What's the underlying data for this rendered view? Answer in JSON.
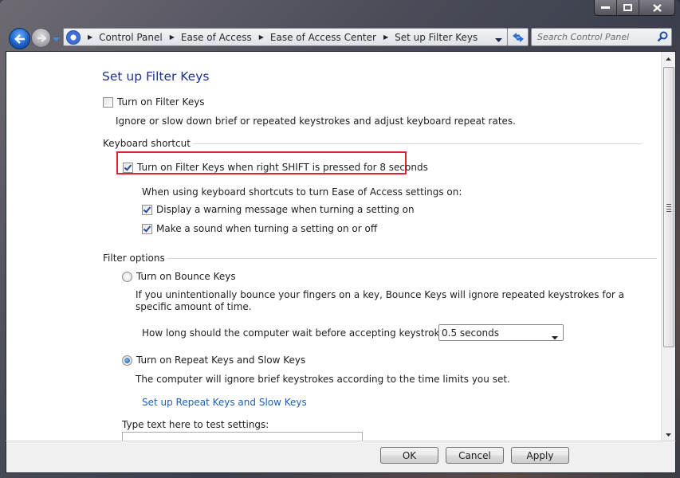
{
  "window": {
    "caption_buttons": {
      "minimize": "minimize",
      "maximize": "maximize",
      "close": "close"
    }
  },
  "nav": {
    "back_icon": "back-arrow",
    "forward_icon": "forward-arrow",
    "recent_pages_icon": "chevron-down"
  },
  "address_bar": {
    "icon": "control-panel-icon",
    "breadcrumbs": [
      "Control Panel",
      "Ease of Access",
      "Ease of Access Center",
      "Set up Filter Keys"
    ]
  },
  "search": {
    "placeholder": "Search Control Panel",
    "value": ""
  },
  "page": {
    "title": "Set up Filter Keys",
    "turn_on_filter_keys": {
      "label": "Turn on Filter Keys",
      "checked": false
    },
    "turn_on_filter_keys_desc": "Ignore or slow down brief or repeated keystrokes and adjust keyboard repeat rates.",
    "keyboard_shortcut": {
      "heading": "Keyboard shortcut",
      "shift_shortcut": {
        "label": "Turn on Filter Keys when right SHIFT is pressed for 8 seconds",
        "checked": true,
        "highlighted": true
      },
      "intro": "When using keyboard shortcuts to turn Ease of Access settings on:",
      "warning_message": {
        "label": "Display a warning message when turning a setting on",
        "checked": true
      },
      "make_sound": {
        "label": "Make a sound when turning a setting on or off",
        "checked": true
      }
    },
    "filter_options": {
      "heading": "Filter options",
      "bounce_keys": {
        "label": "Turn on Bounce Keys",
        "selected": false
      },
      "bounce_desc_line1": "If you unintentionally bounce your fingers on a key, Bounce Keys will ignore repeated keystrokes for a",
      "bounce_desc_line2": "specific amount of time.",
      "wait_question": "How long should the computer wait before accepting keystrokes?",
      "wait_value": "0.5 seconds",
      "repeat_slow_keys": {
        "label": "Turn on Repeat Keys and Slow Keys",
        "selected": true
      },
      "repeat_desc": "The computer will ignore brief keystrokes according to the time limits you set.",
      "setup_link": "Set up Repeat Keys and Slow Keys"
    },
    "test_label": "Type text here to test settings:",
    "test_value": ""
  },
  "footer": {
    "ok": "OK",
    "cancel": "Cancel",
    "apply": "Apply"
  },
  "colors": {
    "title": "#1e3287",
    "link": "#1b5fb3",
    "highlight": "#d9252b"
  }
}
